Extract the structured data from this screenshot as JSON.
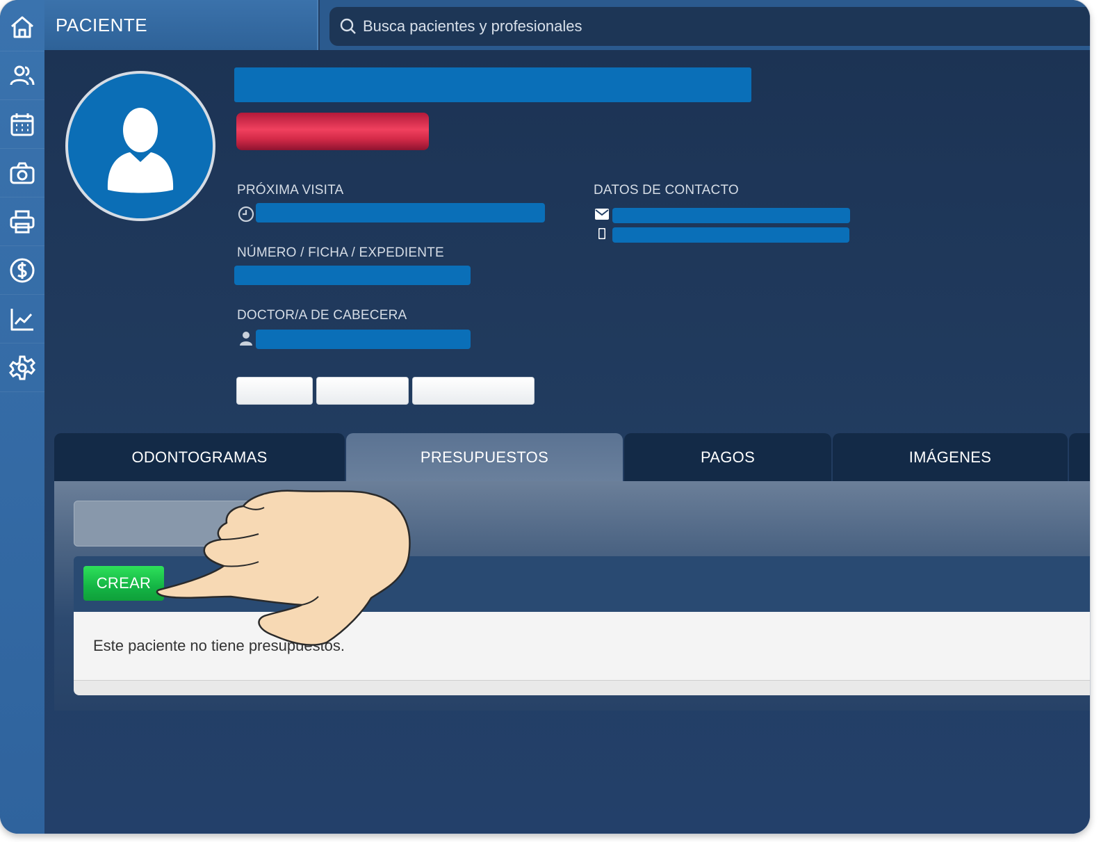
{
  "header": {
    "title": "PACIENTE",
    "search_placeholder": "Busca pacientes y profesionales"
  },
  "sidebar": {
    "items": [
      {
        "icon": "home-icon"
      },
      {
        "icon": "users-icon"
      },
      {
        "icon": "calendar-icon"
      },
      {
        "icon": "camera-icon"
      },
      {
        "icon": "printer-icon"
      },
      {
        "icon": "dollar-icon"
      },
      {
        "icon": "chart-icon"
      },
      {
        "icon": "gear-icon"
      }
    ]
  },
  "patient": {
    "next_visit_label": "PRÓXIMA VISITA",
    "record_label": "NÚMERO / FICHA / EXPEDIENTE",
    "doctor_label": "DOCTOR/A DE CABECERA",
    "contact_label": "DATOS DE CONTACTO"
  },
  "tabs": [
    {
      "label": "ODONTOGRAMAS",
      "active": false
    },
    {
      "label": "PRESUPUESTOS",
      "active": true
    },
    {
      "label": "PAGOS",
      "active": false
    },
    {
      "label": "IMÁGENES",
      "active": false
    }
  ],
  "budgets": {
    "create_label": "CREAR",
    "empty_message": "Este paciente no tiene presupuestos."
  },
  "colors": {
    "accent": "#0a6fb8",
    "create_button": "#14b545",
    "tag": "#e0304f"
  }
}
